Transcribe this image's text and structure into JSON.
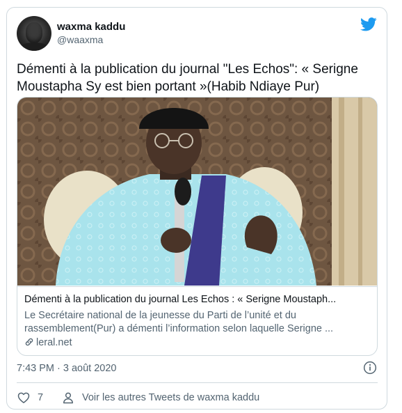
{
  "author": {
    "name": "waxma kaddu",
    "handle": "@waaxma"
  },
  "tweet": {
    "text": "Démenti à la publication du journal \"Les Echos\": « Serigne Moustapha Sy est bien portant »(Habib Ndiaye Pur)",
    "timestamp": "7:43 PM · 3 août 2020"
  },
  "link_card": {
    "title": "Démenti à la publication du journal Les Echos : « Serigne Moustaph...",
    "description": "Le Secrétaire national de la jeunesse du Parti de l’unité et du rassemblement(Pur) a démenti l’information selon laquelle Serigne ...",
    "domain": "leral.net"
  },
  "actions": {
    "like_count": "7",
    "more_tweets_label": "Voir les autres Tweets de waxma kaddu"
  },
  "colors": {
    "twitter_blue": "#1d9bf0",
    "secondary_text": "#536471",
    "border": "#cfd9de"
  },
  "icons": [
    "twitter-bird-icon",
    "link-icon",
    "info-icon",
    "heart-icon",
    "profile-icon"
  ]
}
